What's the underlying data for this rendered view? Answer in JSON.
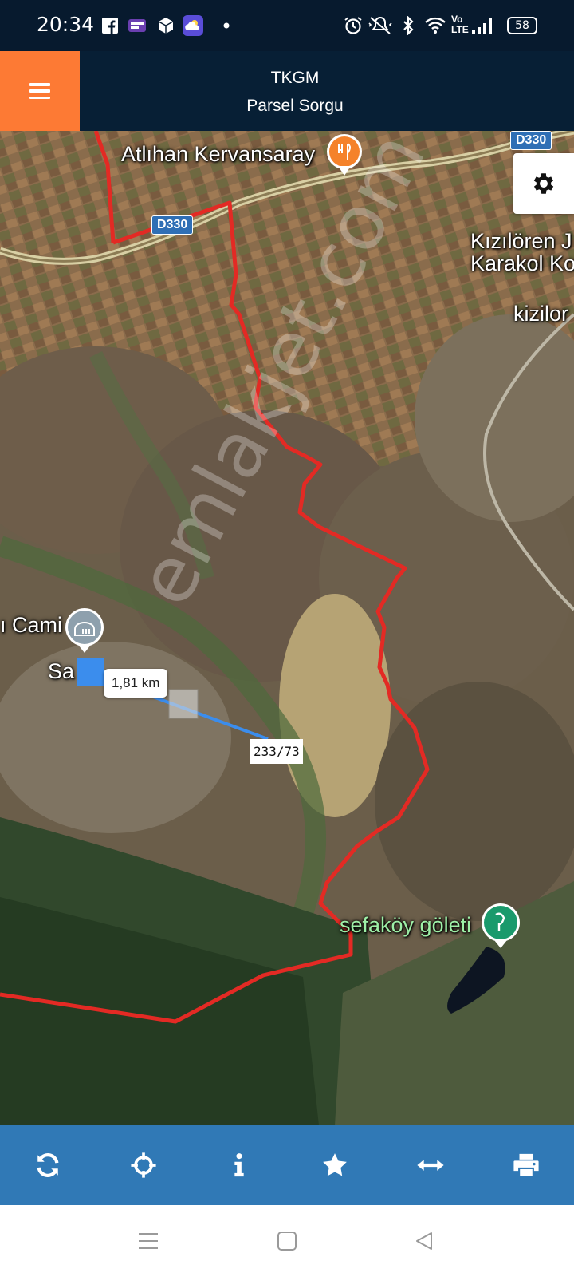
{
  "status_bar": {
    "time": "20:34",
    "battery": "58",
    "left_icons": [
      "facebook-icon",
      "tv-app-icon",
      "box-icon",
      "cloud-app-icon",
      "dot-icon"
    ],
    "right_icons": [
      "alarm-icon",
      "vibrate-icon",
      "bluetooth-icon",
      "wifi-icon",
      "volte-icon",
      "signal-icon",
      "battery-icon"
    ],
    "volte_text": "Vo LTE"
  },
  "header": {
    "title": "TKGM",
    "subtitle": "Parsel Sorgu",
    "accent_color": "#fd7a34",
    "background_color": "#071f35"
  },
  "map": {
    "labels": {
      "caravanserai": "Atlıhan Kervansaray",
      "karakol": "Kızılören J\nKarakol Kon",
      "kizilor": "kizilor",
      "cami": "ı Cami",
      "village": "Sa",
      "pond": "sefaköy göleti"
    },
    "road_shields": [
      "D330",
      "D330"
    ],
    "measure_distance": "1,81 km",
    "parcel_number": "233/73",
    "watermark": "emlakjet.com",
    "boundary_color": "#e32a24",
    "measure_line_color": "#3b8ded"
  },
  "toolbar": {
    "buttons": [
      "refresh-icon",
      "crosshair-icon",
      "info-icon",
      "star-icon",
      "measure-arrows-icon",
      "print-icon"
    ],
    "background_color": "#3079b6"
  },
  "nav_bar": {
    "buttons": [
      "recent-apps",
      "home",
      "back"
    ]
  }
}
